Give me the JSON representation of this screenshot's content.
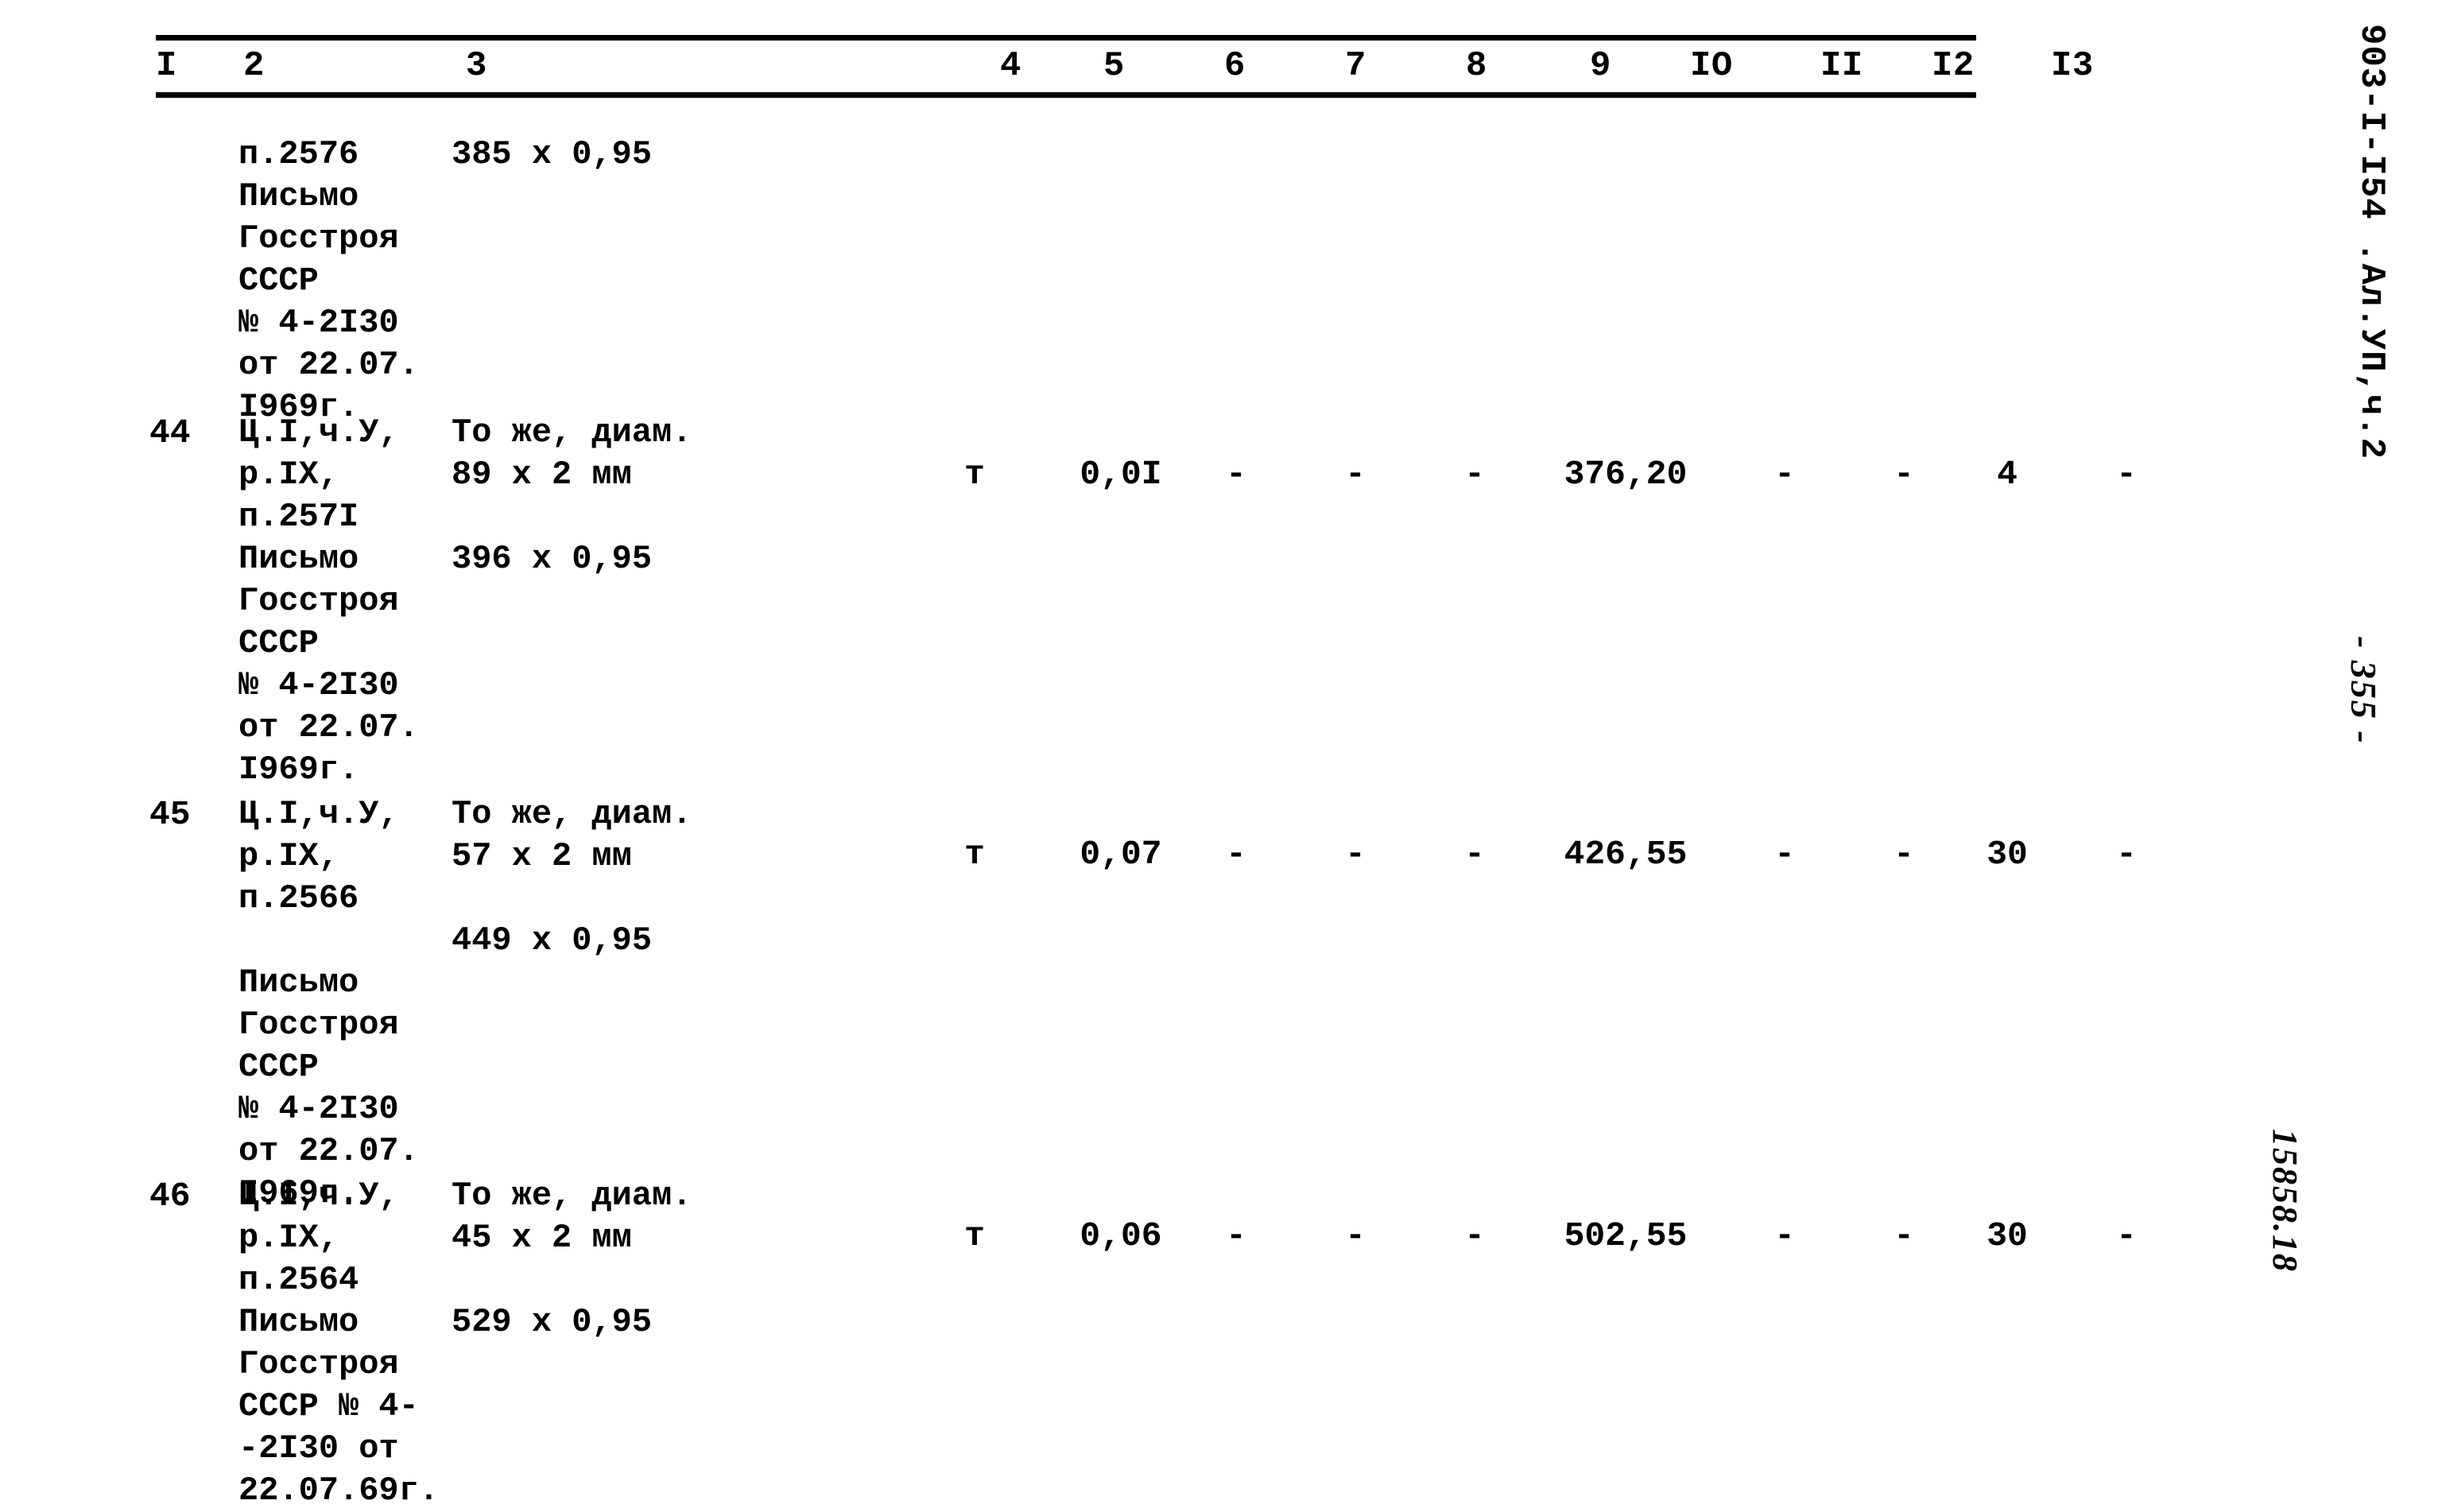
{
  "document": {
    "code": "903-I-I54 .Ал.УП,ч.2",
    "page_number": "- 355 -",
    "stamp_number": "15858.18"
  },
  "table": {
    "column_headers": [
      "I",
      "2",
      "3",
      "4",
      "5",
      "6",
      "7",
      "8",
      "9",
      "IO",
      "II",
      "I2",
      "I3"
    ],
    "rows": [
      {
        "no": "",
        "justification": [
          "п.2576",
          "Письмо",
          "Госстроя",
          "СССР",
          "№ 4-2I30",
          "от 22.07.",
          "I969г."
        ],
        "description": [
          "385 x 0,95"
        ],
        "unit": "",
        "qty": "",
        "c6": "",
        "c7": "",
        "c8": "",
        "price": "",
        "c10": "",
        "c11": "",
        "c12": "",
        "c13": ""
      },
      {
        "no": "44",
        "justification": [
          "Ц.I,ч.У,",
          "р.IХ,",
          "п.257I",
          "Письмо",
          "Госстроя",
          "СССР",
          "№ 4-2I30",
          "от 22.07.",
          "I969г."
        ],
        "description": [
          "То же, диам.",
          "89 x 2 мм",
          "",
          "396 x 0,95"
        ],
        "unit": "т",
        "qty": "0,0I",
        "c6": "-",
        "c7": "-",
        "c8": "-",
        "price": "376,20",
        "c10": "-",
        "c11": "-",
        "c12": "4",
        "c13": "-"
      },
      {
        "no": "45",
        "justification": [
          "Ц.I,ч.У,",
          "р.IХ,",
          "п.2566",
          "",
          "Письмо",
          "Госстроя",
          "СССР",
          "№ 4-2I30",
          "от 22.07.",
          "I969г."
        ],
        "description": [
          "То же, диам.",
          "57 x 2 мм",
          "",
          "449 x 0,95"
        ],
        "unit": "т",
        "qty": "0,07",
        "c6": "-",
        "c7": "-",
        "c8": "-",
        "price": "426,55",
        "c10": "-",
        "c11": "-",
        "c12": "30",
        "c13": "-"
      },
      {
        "no": "46",
        "justification": [
          "Ц.I,ч.У,",
          "р.IХ,",
          "п.2564",
          "Письмо",
          "Госстроя",
          "СССР № 4-",
          "-2I30 от",
          "22.07.69г."
        ],
        "description": [
          "То же, диам.",
          "45 x 2 мм",
          "",
          "529 x 0,95"
        ],
        "unit": "т",
        "qty": "0,06",
        "c6": "-",
        "c7": "-",
        "c8": "-",
        "price": "502,55",
        "c10": "-",
        "c11": "-",
        "c12": "30",
        "c13": "-"
      }
    ]
  }
}
